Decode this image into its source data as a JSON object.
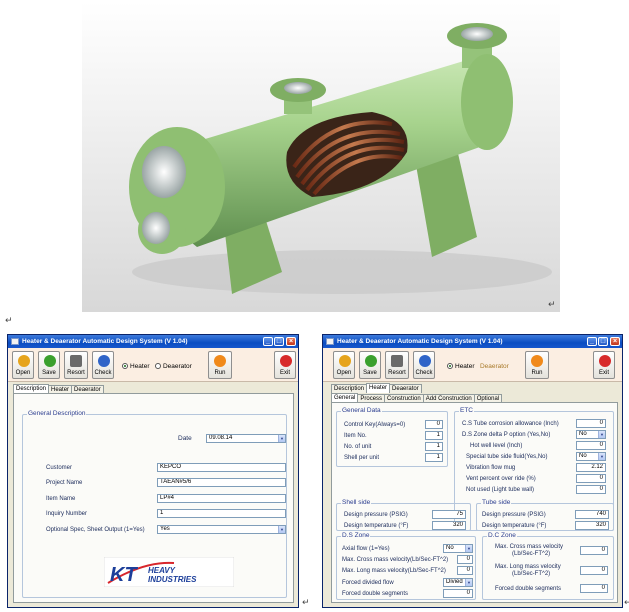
{
  "page": {
    "paragraph_mark": "↵"
  },
  "windows": [
    {
      "title": "Heater & Deaerator Automatic Design System (V 1.04)",
      "toolbar": [
        {
          "label": "Open",
          "icon": "open-icon",
          "color": "#e6a41c"
        },
        {
          "label": "Save",
          "icon": "save-icon",
          "color": "#3aa02e"
        },
        {
          "label": "Resort",
          "icon": "resort-icon",
          "color": "#6a6a6a"
        },
        {
          "label": "Check",
          "icon": "check-icon",
          "color": "#2f64c8"
        }
      ],
      "mode": {
        "heater": "Heater",
        "deaerator": "Deaerator",
        "selected": "Heater"
      },
      "run_label": "Run",
      "exit_label": "Exit",
      "tabs": [
        "Description",
        "Heater",
        "Deaerator"
      ],
      "active_tab": "Description",
      "group_title": "General Description",
      "fields": {
        "date": {
          "label": "Date",
          "value": "09.08.14"
        },
        "customer": {
          "label": "Customer",
          "value": "KEPCO"
        },
        "project_name": {
          "label": "Project Name",
          "value": "TAEAN#5/6"
        },
        "item_name": {
          "label": "Item Name",
          "value": "LP#4"
        },
        "inquiry_number": {
          "label": "Inquiry Number",
          "value": "1"
        },
        "optional_spec": {
          "label": "Optional Spec, Sheet Output (1=Yes)",
          "value": "Yes"
        }
      },
      "logo": {
        "letters": "KT",
        "line1": "HEAVY",
        "line2": "INDUSTRIES",
        "color": "#1d3f9a",
        "accent": "#d8262c"
      }
    },
    {
      "title": "Heater & Deaerator Automatic Design System (V 1.04)",
      "toolbar": [
        {
          "label": "Open",
          "icon": "open-icon",
          "color": "#e6a41c"
        },
        {
          "label": "Save",
          "icon": "save-icon",
          "color": "#3aa02e"
        },
        {
          "label": "Resort",
          "icon": "resort-icon",
          "color": "#6a6a6a"
        },
        {
          "label": "Check",
          "icon": "check-icon",
          "color": "#2f64c8"
        }
      ],
      "mode": {
        "heater": "Heater",
        "deaerator": "Deaerator",
        "selected": "Heater"
      },
      "run_label": "Run",
      "exit_label": "Exit",
      "outer_tabs": [
        "Description",
        "Heater",
        "Deaerator"
      ],
      "inner_tabs": [
        "General",
        "Process",
        "Construction",
        "Add Construction",
        "Optional"
      ],
      "general_data": {
        "title": "General Data",
        "rows": [
          {
            "label": "Control Key(Always=0)",
            "value": "0"
          },
          {
            "label": "Item No.",
            "value": "1"
          },
          {
            "label": "No. of unit",
            "value": "1"
          },
          {
            "label": "Shell per unit",
            "value": "1"
          }
        ]
      },
      "etc": {
        "title": "ETC",
        "rows": [
          {
            "label": "C.S Tube corrosion allowance (Inch)",
            "value": "0"
          },
          {
            "label": "D.S Zone delta P option (Yes,No)",
            "value": "No",
            "dropdown": true
          },
          {
            "label": "Hot well level (Inch)",
            "value": "0"
          },
          {
            "label": "Special tube side fluid(Yes,No)",
            "value": "No",
            "dropdown": true
          },
          {
            "label": "Vibration flow mug",
            "value": "2.12"
          },
          {
            "label": "Vent percent over ride (%)",
            "value": "0"
          },
          {
            "label": "Not used (Light tube wall)",
            "value": "0"
          }
        ]
      },
      "shell_side": {
        "title": "Shell side",
        "rows": [
          {
            "label": "Design pressure (PSIG)",
            "value": "75"
          },
          {
            "label": "Design temperature (°F)",
            "value": "320"
          }
        ]
      },
      "tube_side": {
        "title": "Tube side",
        "rows": [
          {
            "label": "Design pressure (PSIG)",
            "value": "740"
          },
          {
            "label": "Design temperature (°F)",
            "value": "320"
          }
        ]
      },
      "ds_zone": {
        "title": "D.S Zone",
        "rows": [
          {
            "label": "Axial flow (1=Yes)",
            "value": "No",
            "dropdown": true
          },
          {
            "label": "Max. Cross mass velocity(Lb/Sec-FT^2)",
            "value": "0"
          },
          {
            "label": "Max. Long mass velocity(Lb/Sec-FT^2)",
            "value": "0"
          },
          {
            "label": "Forced divided flow",
            "value": "Divied",
            "dropdown": true
          },
          {
            "label": "Forced double segments",
            "value": "0"
          }
        ]
      },
      "dc_zone": {
        "title": "D.C Zone",
        "rows": [
          {
            "label": "Max. Cross mass velocity",
            "sub": "(Lb/Sec-FT^2)",
            "value": "0"
          },
          {
            "label": "Max. Long mass velocity",
            "sub": "(Lb/Sec-FT^2)",
            "value": "0"
          },
          {
            "label": "Forced double segments",
            "value": "0"
          }
        ]
      }
    }
  ]
}
